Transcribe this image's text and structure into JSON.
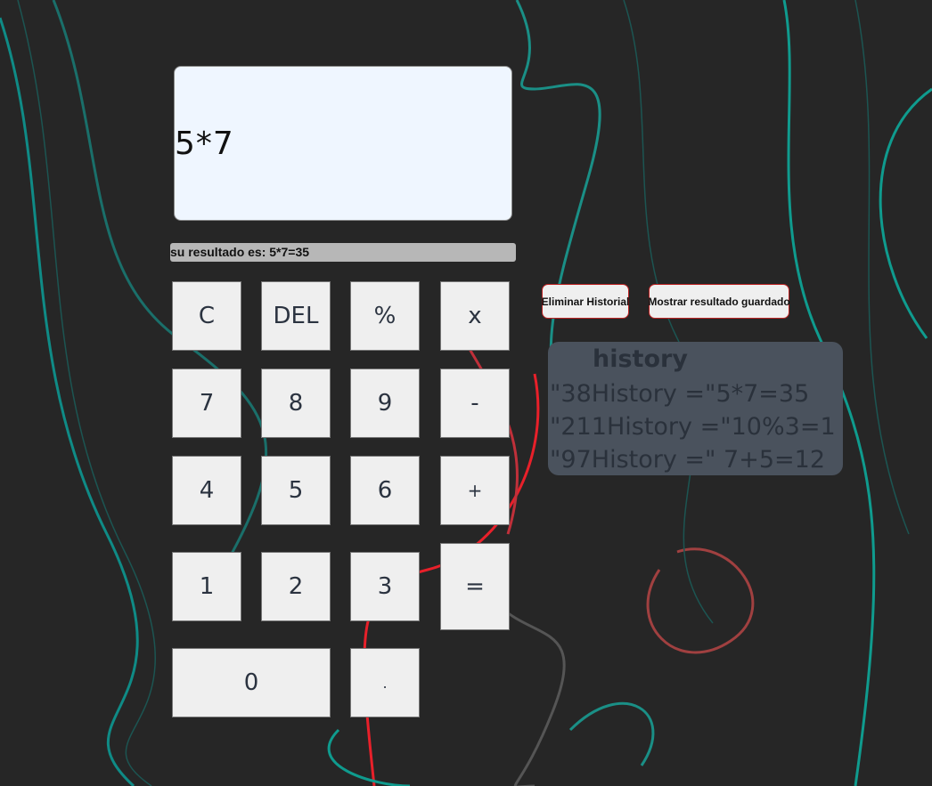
{
  "display": {
    "value": "5*7"
  },
  "result": {
    "text": "su resultado es: 5*7=35"
  },
  "keys": {
    "c": "C",
    "del": "DEL",
    "percent": "%",
    "multiply": "x",
    "k7": "7",
    "k8": "8",
    "k9": "9",
    "minus": "-",
    "k4": "4",
    "k5": "5",
    "k6": "6",
    "plus": "+",
    "k1": "1",
    "k2": "2",
    "k3": "3",
    "equals": "=",
    "k0": "0",
    "dot": "."
  },
  "actions": {
    "clear_history": "Eliminar Historial",
    "show_saved": "Mostrar resultado guardado"
  },
  "history": {
    "title": "history",
    "items": [
      "\"38History =\"5*7=35",
      "\"211History =\"10%3=1",
      "\"97History =\" 7+5=12"
    ]
  },
  "colors": {
    "background": "#262626",
    "teal": "#0f9b8e",
    "red": "#e8202a",
    "display": "#eff6ff",
    "history_panel": "#4a525d"
  }
}
